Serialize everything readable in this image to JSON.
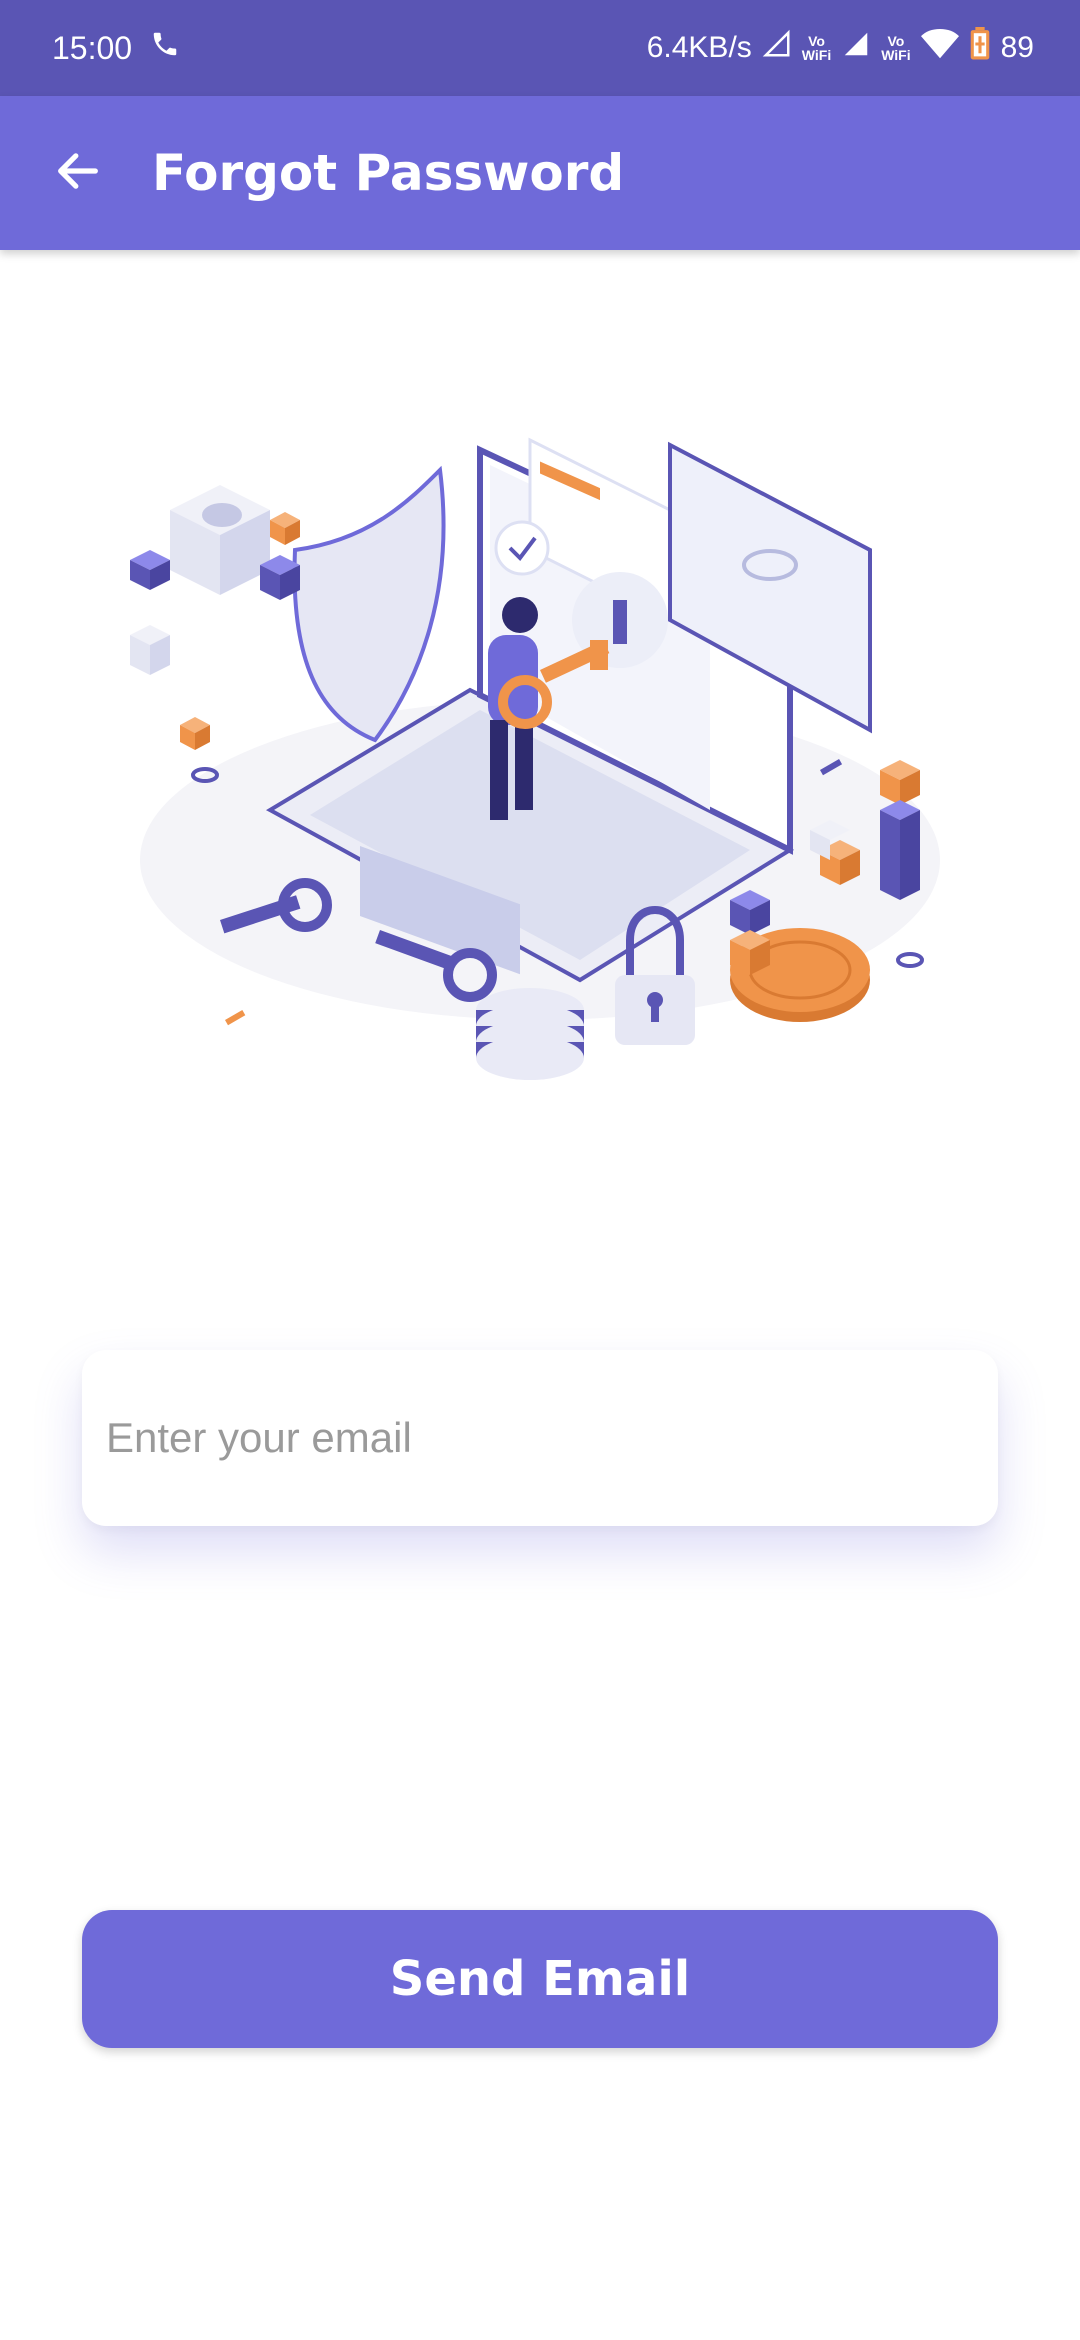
{
  "status_bar": {
    "time": "15:00",
    "network_speed": "6.4KB/s",
    "sim1_label": "Vo\nWiFi",
    "sim2_label": "Vo\nWiFi",
    "battery": "89"
  },
  "app_bar": {
    "title": "Forgot Password",
    "back_icon": "arrow-left-icon"
  },
  "form": {
    "email_placeholder": "Enter your email",
    "email_value": "",
    "submit_label": "Send Email"
  },
  "colors": {
    "status_bar": "#5a55b4",
    "primary": "#6f6ad9",
    "accent_orange": "#f0944a"
  }
}
